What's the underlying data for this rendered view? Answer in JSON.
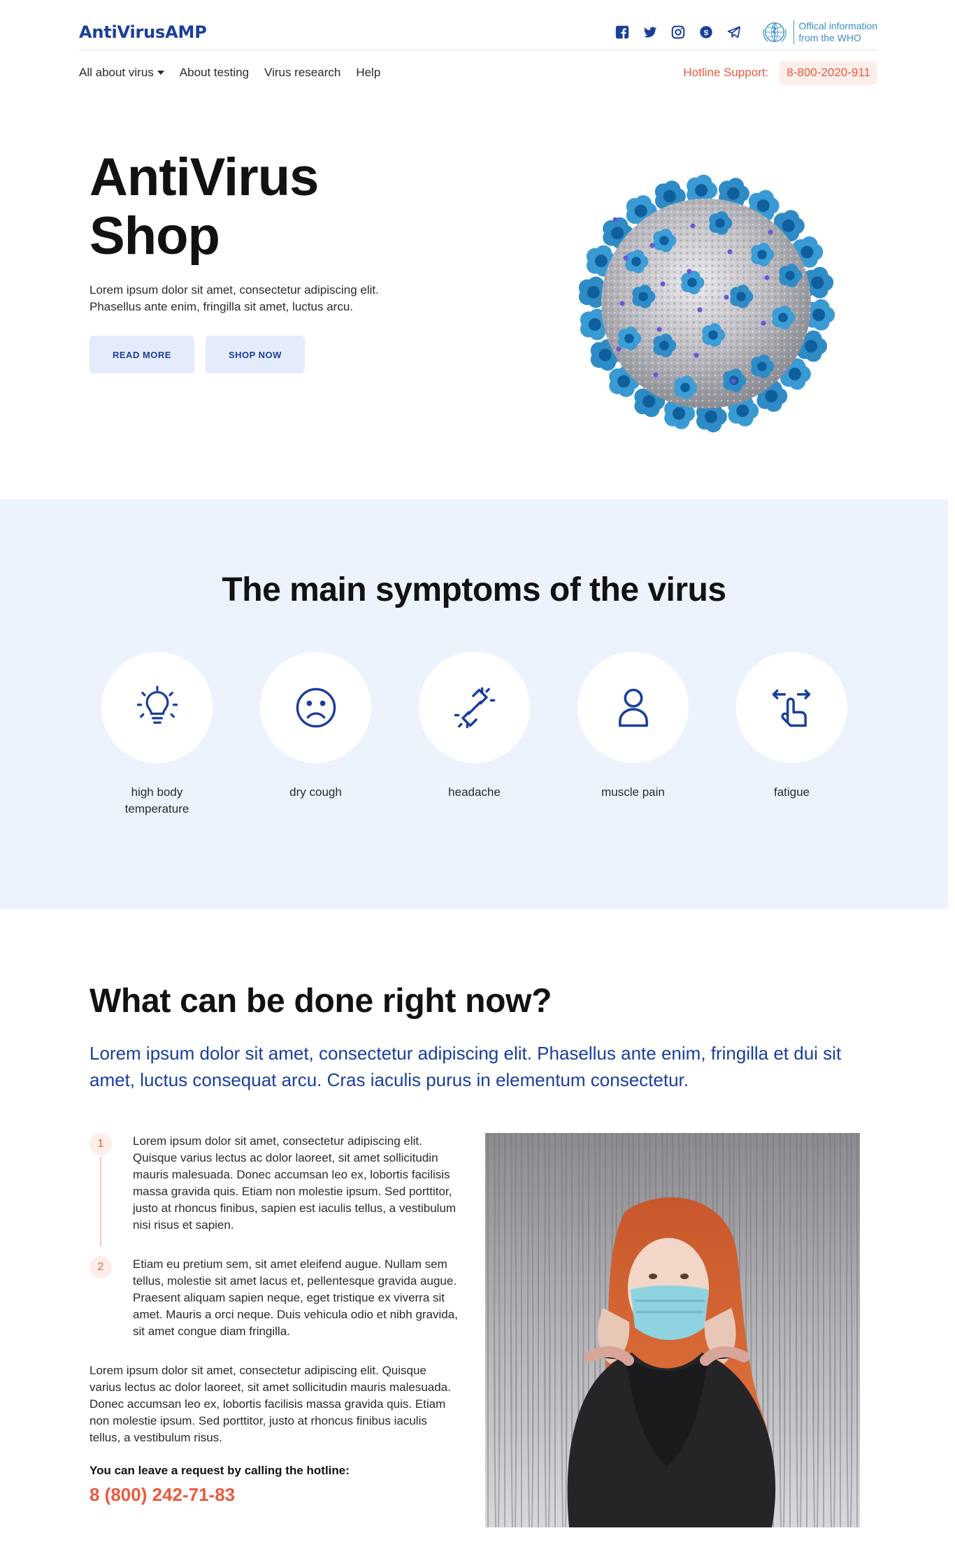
{
  "header": {
    "brand": "AntiVirusAMP",
    "socials": [
      "facebook-icon",
      "twitter-icon",
      "instagram-icon",
      "skype-icon",
      "telegram-icon"
    ],
    "who_line1": "Offical information",
    "who_line2": "from the WHO"
  },
  "nav": {
    "items": [
      "All about virus",
      "About testing",
      "Virus research",
      "Help"
    ],
    "hotline_label": "Hotline Support:",
    "hotline_number": "8-800-2020-911"
  },
  "hero": {
    "title_line1": "AntiVirus",
    "title_line2": "Shop",
    "text": "Lorem ipsum dolor sit amet, consectetur adipiscing elit. Phasellus ante enim, fringilla sit amet, luctus arcu.",
    "read_more": "READ MORE",
    "shop_now": "SHOP NOW"
  },
  "symptoms": {
    "title": "The main symptoms of the virus",
    "items": [
      {
        "label": "high body temperature",
        "icon": "lightbulb-icon"
      },
      {
        "label": "dry cough",
        "icon": "sad-face-icon"
      },
      {
        "label": "headache",
        "icon": "broken-link-icon"
      },
      {
        "label": "muscle pain",
        "icon": "person-icon"
      },
      {
        "label": "fatigue",
        "icon": "swipe-hand-icon"
      }
    ]
  },
  "what_done": {
    "title": "What can be done right now?",
    "lead": "Lorem ipsum dolor sit amet, consectetur adipiscing elit. Phasellus ante enim, fringilla et dui sit amet, luctus consequat arcu. Cras iaculis purus in elementum consectetur.",
    "steps": [
      {
        "num": "1",
        "text": "Lorem ipsum dolor sit amet, consectetur adipiscing elit. Quisque varius lectus ac dolor laoreet, sit amet sollicitudin mauris malesuada. Donec accumsan leo ex, lobortis facilisis massa gravida quis. Etiam non molestie ipsum. Sed porttitor, justo at rhoncus finibus, sapien est iaculis tellus, a vestibulum nisi risus et sapien."
      },
      {
        "num": "2",
        "text": "Etiam eu pretium sem, sit amet eleifend augue. Nullam sem tellus, molestie sit amet lacus et, pellentesque gravida augue. Praesent aliquam sapien neque, eget tristique ex viverra sit amet. Mauris a orci neque. Duis vehicula odio et nibh gravida, sit amet congue diam fringilla."
      }
    ],
    "paragraph": "Lorem ipsum dolor sit amet, consectetur adipiscing elit. Quisque varius lectus ac dolor laoreet, sit amet sollicitudin mauris malesuada. Donec accumsan leo ex, lobortis facilisis massa gravida quis. Etiam non molestie ipsum. Sed porttitor, justo at rhoncus finibus iaculis tellus, a vestibulum risus.",
    "call_label": "You can leave a request by calling the hotline:",
    "call_number": "8 (800) 242-71-83"
  },
  "colors": {
    "brand": "#1a3e9c",
    "accent": "#ea5a3f",
    "section_bg": "#edf3fd"
  }
}
